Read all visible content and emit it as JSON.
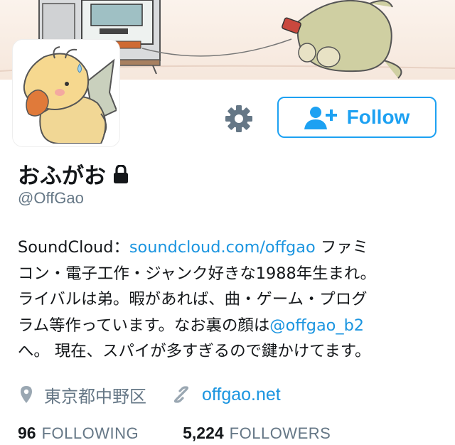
{
  "profile": {
    "display_name": "おふがお",
    "handle": "@OffGao",
    "bio": {
      "line1_prefix": "SoundCloud：",
      "line1_link": "soundcloud.com/offgao",
      "line1_suffix": " ファミ",
      "line2": "コン・電子工作・ジャンク好きな1988年生まれ。",
      "line3": "ライバルは弟。暇があれば、曲・ゲーム・プログ",
      "line4_prefix": "ラム等作っています。なお裏の顔は",
      "line4_link": "@offgao_b2",
      "line5": "へ。 現在、スパイが多すぎるので鍵かけてます。"
    },
    "location": "東京都中野区",
    "website": "offgao.net",
    "following_count": "96",
    "following_label": "FOLLOWING",
    "followers_count": "5,224",
    "followers_label": "FOLLOWERS"
  },
  "actions": {
    "follow_label": "Follow"
  },
  "icons": {
    "settings": "gear-icon",
    "follow": "add-user-icon",
    "protected": "lock-icon",
    "location": "map-pin-icon",
    "website": "link-icon"
  },
  "colors": {
    "accent": "#1da1f2",
    "link": "#1b95e0",
    "muted": "#657786",
    "text": "#14171a"
  }
}
